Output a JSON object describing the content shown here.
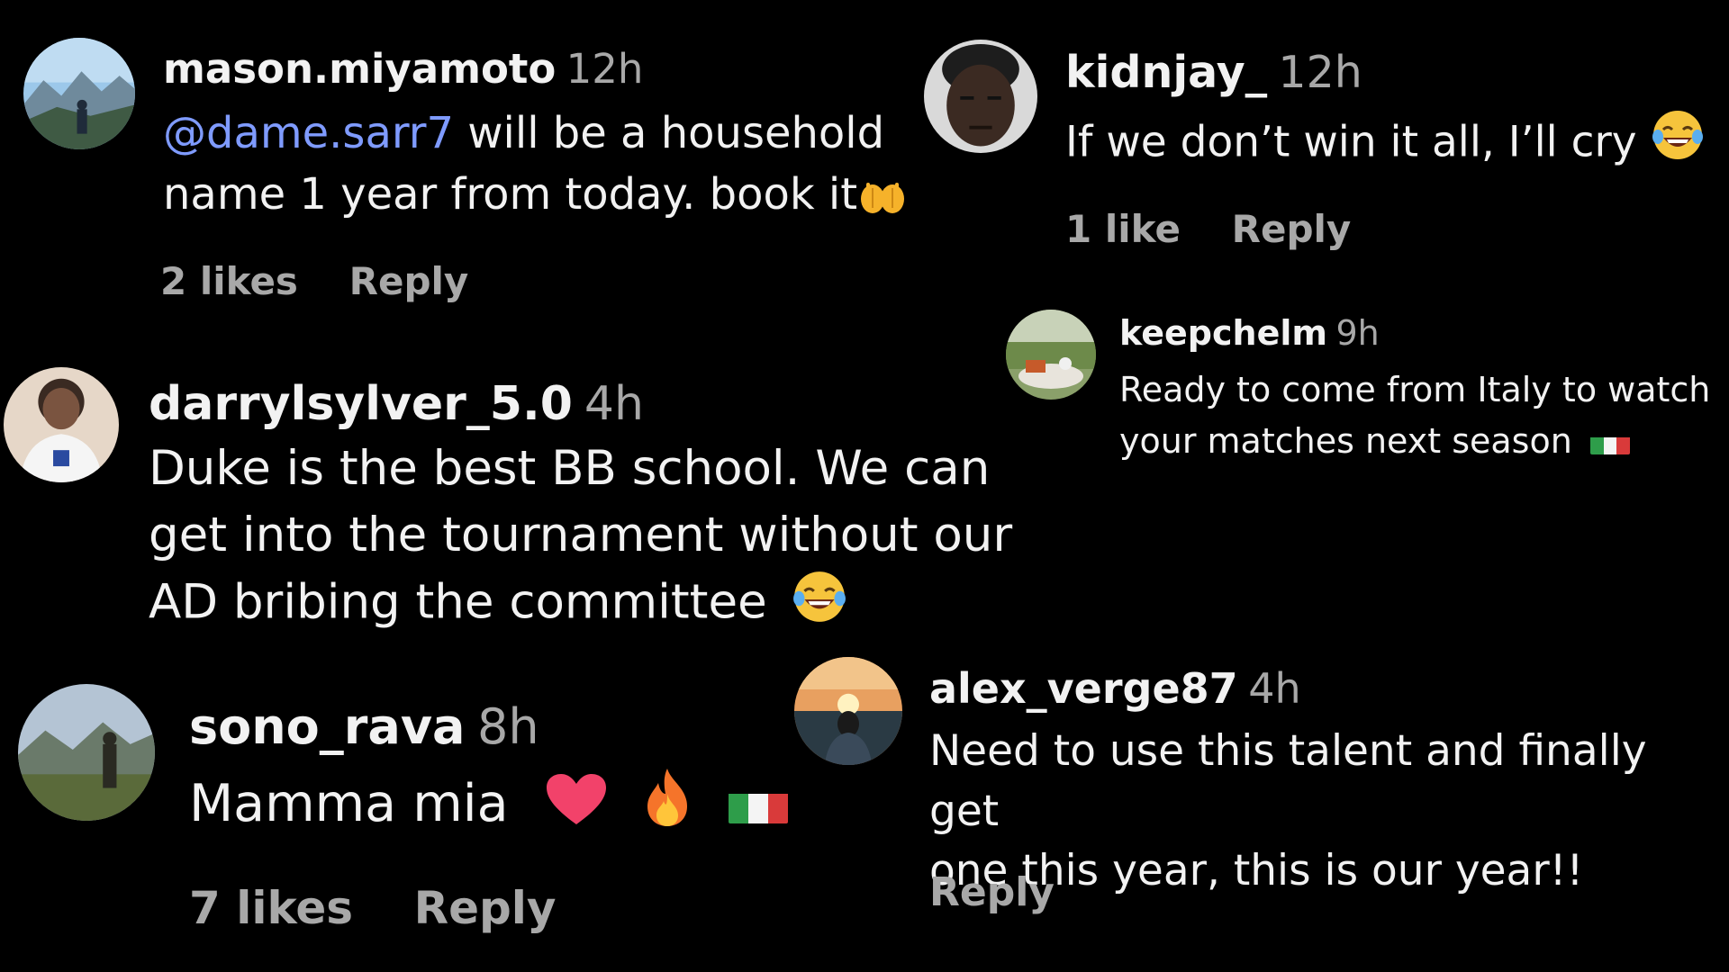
{
  "comments": [
    {
      "username": "mason.miyamoto",
      "time": "12h",
      "mention": "@dame.sarr7",
      "text_line1": " will be a household",
      "text_line2": "name 1 year from today. book it",
      "likes": "2 likes",
      "reply": "Reply",
      "emoji": "raising-hands-icon"
    },
    {
      "username": "kidnjay_",
      "time": "12h",
      "text": "If we don’t win it all, I’ll cry",
      "likes": "1 like",
      "reply": "Reply",
      "emoji": "laughing-crying-face-icon"
    },
    {
      "username": "keepchelm",
      "time": "9h",
      "text_line1": "Ready to come from Italy to watch",
      "text_line2": "your matches next season",
      "emoji": "italy-flag-icon"
    },
    {
      "username": "darrylsylver_5.0",
      "time": "4h",
      "text_line1": "Duke is the best BB school. We can",
      "text_line2": "get into the tournament without our",
      "text_line3": "AD bribing the committee",
      "emoji": "laughing-crying-face-icon"
    },
    {
      "username": "sono_rava",
      "time": "8h",
      "text": "Mamma mia",
      "likes": "7 likes",
      "reply": "Reply",
      "emojis": [
        "red-heart-icon",
        "fire-icon",
        "italy-flag-icon"
      ]
    },
    {
      "username": "alex_verge87",
      "time": "4h",
      "text_line1": "Need to use this talent and finally get",
      "text_line2": "one this year, this is our year!!",
      "reply": "Reply"
    }
  ],
  "colors": {
    "background": "#000000",
    "username": "#f2f2f2",
    "meta": "#a8a8a8",
    "mention": "#7f9bff",
    "flag_green": "#2e9d4a",
    "flag_white": "#f4f4f4",
    "flag_red": "#d93a3a"
  }
}
